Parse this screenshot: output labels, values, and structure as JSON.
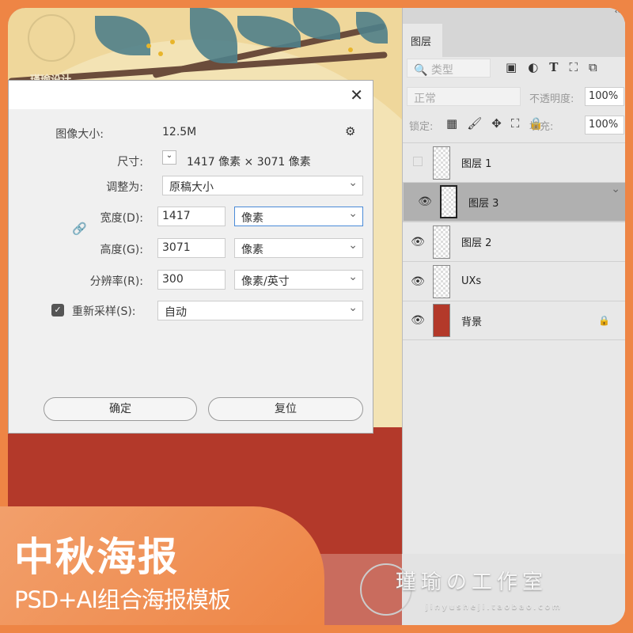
{
  "poster": {
    "logo_text": "瑾瑜设计"
  },
  "dialog": {
    "image_size_label": "图像大小:",
    "image_size_value": "12.5M",
    "dimensions_label": "尺寸:",
    "dimensions_value": "1417 像素  ×  3071 像素",
    "fit_to_label": "调整为:",
    "fit_to_value": "原稿大小",
    "width_label": "宽度(D):",
    "width_value": "1417",
    "width_unit": "像素",
    "height_label": "高度(G):",
    "height_value": "3071",
    "height_unit": "像素",
    "resolution_label": "分辨率(R):",
    "resolution_value": "300",
    "resolution_unit": "像素/英寸",
    "resample_label": "重新采样(S):",
    "resample_checked": true,
    "resample_value": "自动",
    "ok": "确定",
    "reset": "复位"
  },
  "panel": {
    "collapse": "‹‹",
    "tab": "图层",
    "filter_placeholder": "类型",
    "blend_mode": "正常",
    "opacity_label": "不透明度:",
    "opacity_value": "100%",
    "lock_label": "锁定:",
    "fill_label": "填充:",
    "fill_value": "100%",
    "layers": [
      {
        "name": "图层 1",
        "visible": false,
        "selected": false
      },
      {
        "name": "图层 3",
        "visible": true,
        "selected": true
      },
      {
        "name": "图层 2",
        "visible": true,
        "selected": false
      },
      {
        "name": "UXs",
        "visible": true,
        "selected": false
      },
      {
        "name": "背景",
        "visible": true,
        "selected": false,
        "locked": true
      }
    ]
  },
  "banner": {
    "title": "中秋海报",
    "subtitle": "PSD+AI组合海报模板"
  },
  "watermark": {
    "name": "瑾瑜の工作室",
    "url": "jinyusheji.taobao.com"
  }
}
